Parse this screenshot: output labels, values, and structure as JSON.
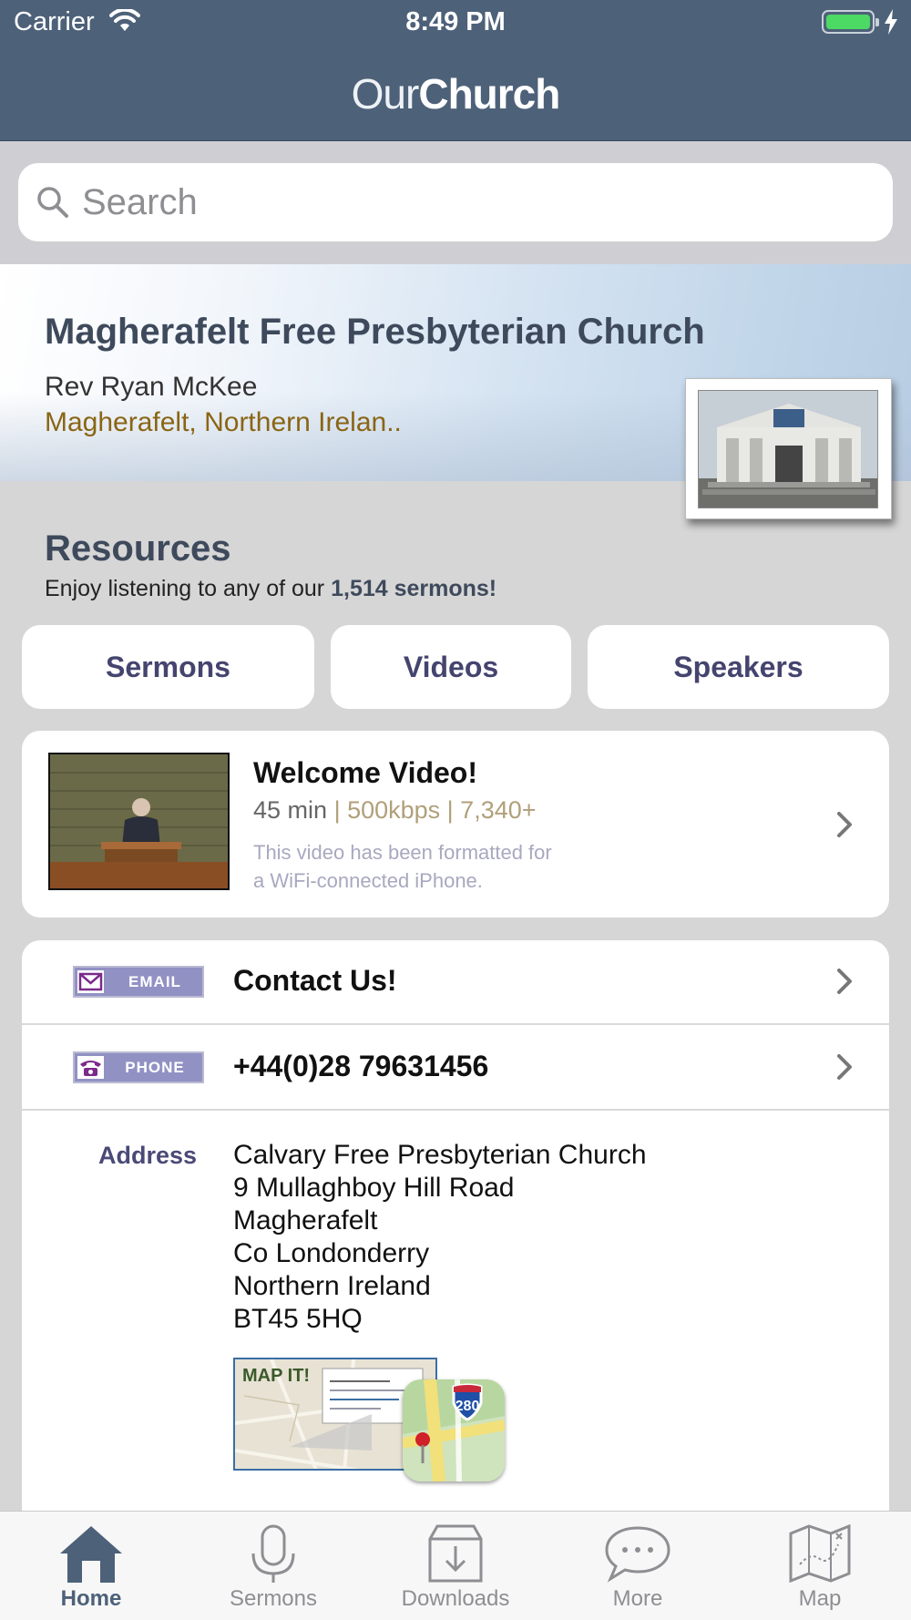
{
  "status": {
    "carrier": "Carrier",
    "time": "8:49 PM"
  },
  "app": {
    "logo_light": "Our",
    "logo_bold": "Church"
  },
  "search": {
    "placeholder": "Search"
  },
  "church": {
    "name": "Magherafelt Free Presbyterian Church",
    "pastor": "Rev Ryan McKee",
    "location": "Magherafelt, Northern Irelan.."
  },
  "resources": {
    "title": "Resources",
    "subtitle_prefix": "Enjoy listening to any of our",
    "subtitle_bold": "1,514 sermons!",
    "buttons": [
      "Sermons",
      "Videos",
      "Speakers"
    ]
  },
  "video": {
    "title": "Welcome Video!",
    "duration": "45 min",
    "meta": "| 500kbps | 7,340+",
    "desc_line1": "This video has been formatted for",
    "desc_line2": "a WiFi-connected iPhone."
  },
  "contact": {
    "email_badge": "EMAIL",
    "email_label": "Contact Us!",
    "phone_badge": "PHONE",
    "phone_number": "+44(0)28 79631456",
    "address_label": "Address",
    "address_lines": [
      "Calvary Free Presbyterian Church",
      "9 Mullaghboy Hill Road",
      "Magherafelt",
      "Co Londonderry",
      "Northern Ireland",
      "BT45 5HQ"
    ],
    "map_label": "MAP IT!",
    "highway_number": "280"
  },
  "tabs": [
    {
      "label": "Home",
      "icon": "home-icon",
      "active": true
    },
    {
      "label": "Sermons",
      "icon": "microphone-icon",
      "active": false
    },
    {
      "label": "Downloads",
      "icon": "download-box-icon",
      "active": false
    },
    {
      "label": "More",
      "icon": "chat-bubble-icon",
      "active": false
    },
    {
      "label": "Map",
      "icon": "map-icon",
      "active": false
    }
  ],
  "colors": {
    "nav_bar": "#4d6179",
    "accent_text": "#44446f",
    "location_text": "#8a6514",
    "battery": "#4cd964"
  }
}
